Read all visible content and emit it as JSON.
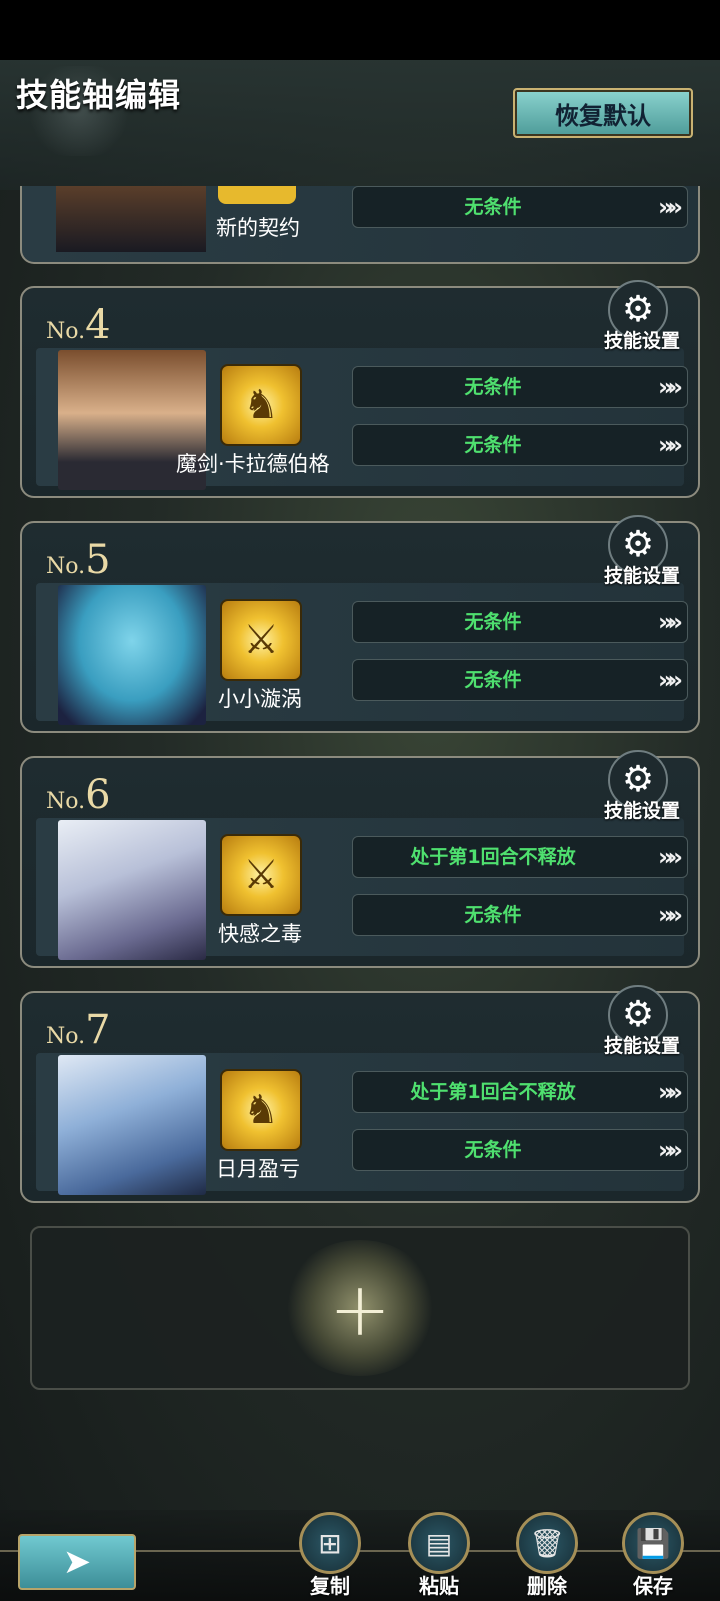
{
  "header": {
    "title": "技能轴编辑",
    "restore_label": "恢复默认"
  },
  "partial_card": {
    "skill_name": "新的契约",
    "condition": "无条件"
  },
  "cards": [
    {
      "number": "4",
      "no_prefix": "No.",
      "settings_label": "技能设置",
      "skill_name": "魔剑·卡拉德伯格",
      "skill_icon": "golden-knight-icon",
      "conditions": [
        "无条件",
        "无条件"
      ]
    },
    {
      "number": "5",
      "no_prefix": "No.",
      "settings_label": "技能设置",
      "skill_name": "小小漩涡",
      "skill_icon": "crossed-swords-icon",
      "conditions": [
        "无条件",
        "无条件"
      ]
    },
    {
      "number": "6",
      "no_prefix": "No.",
      "settings_label": "技能设置",
      "skill_name": "快感之毒",
      "skill_icon": "crossed-swords-icon",
      "conditions": [
        "处于第1回合不释放",
        "无条件"
      ]
    },
    {
      "number": "7",
      "no_prefix": "No.",
      "settings_label": "技能设置",
      "skill_name": "日月盈亏",
      "skill_icon": "golden-knight-icon",
      "conditions": [
        "处于第1回合不释放",
        "无条件"
      ]
    }
  ],
  "add_panel": {
    "icon": "plus-icon"
  },
  "toolbar": {
    "copy": "复制",
    "paste": "粘贴",
    "delete": "删除",
    "save": "保存"
  },
  "arrow_glyph": "»»",
  "colors": {
    "condition_text": "#4fe06f",
    "accent_teal": "#71c9d0",
    "gold_border": "#c9b272"
  }
}
